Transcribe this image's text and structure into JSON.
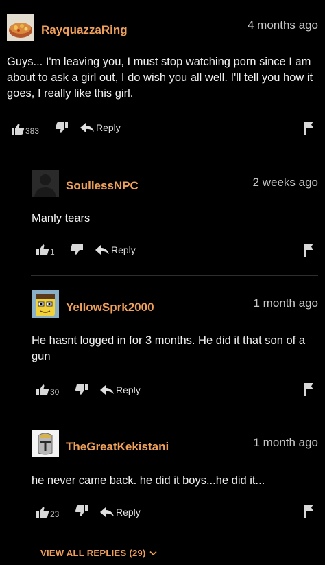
{
  "comments": [
    {
      "username": "RayquazzaRing",
      "time": "4 months ago",
      "text": "Guys... I'm leaving you, I must stop watching porn since I am about to ask a girl out, I do wish you all well. I'll tell you how it goes, I really like this girl.",
      "likes": "383",
      "reply_label": "Reply",
      "avatar_icon": "food-bowl-avatar-icon"
    },
    {
      "username": "SoullessNPC",
      "time": "2 weeks ago",
      "text": "Manly tears",
      "likes": "1",
      "reply_label": "Reply",
      "avatar_icon": "silhouette-avatar-icon"
    },
    {
      "username": "YellowSprk2000",
      "time": "1 month ago",
      "text": "He hasnt logged in for 3 months. He did it that son of a gun",
      "likes": "30",
      "reply_label": "Reply",
      "avatar_icon": "cartoon-face-avatar-icon"
    },
    {
      "username": "TheGreatKekistani",
      "time": "1 month ago",
      "text": "he never came back. he did it boys...he did it...",
      "likes": "23",
      "reply_label": "Reply",
      "avatar_icon": "knight-helmet-avatar-icon"
    }
  ],
  "view_all_replies": "VIEW ALL REPLIES (29)",
  "colors": {
    "background": "#000000",
    "username": "#f0a05a",
    "text": "#f2f2f2",
    "muted": "#c8c8c8"
  }
}
